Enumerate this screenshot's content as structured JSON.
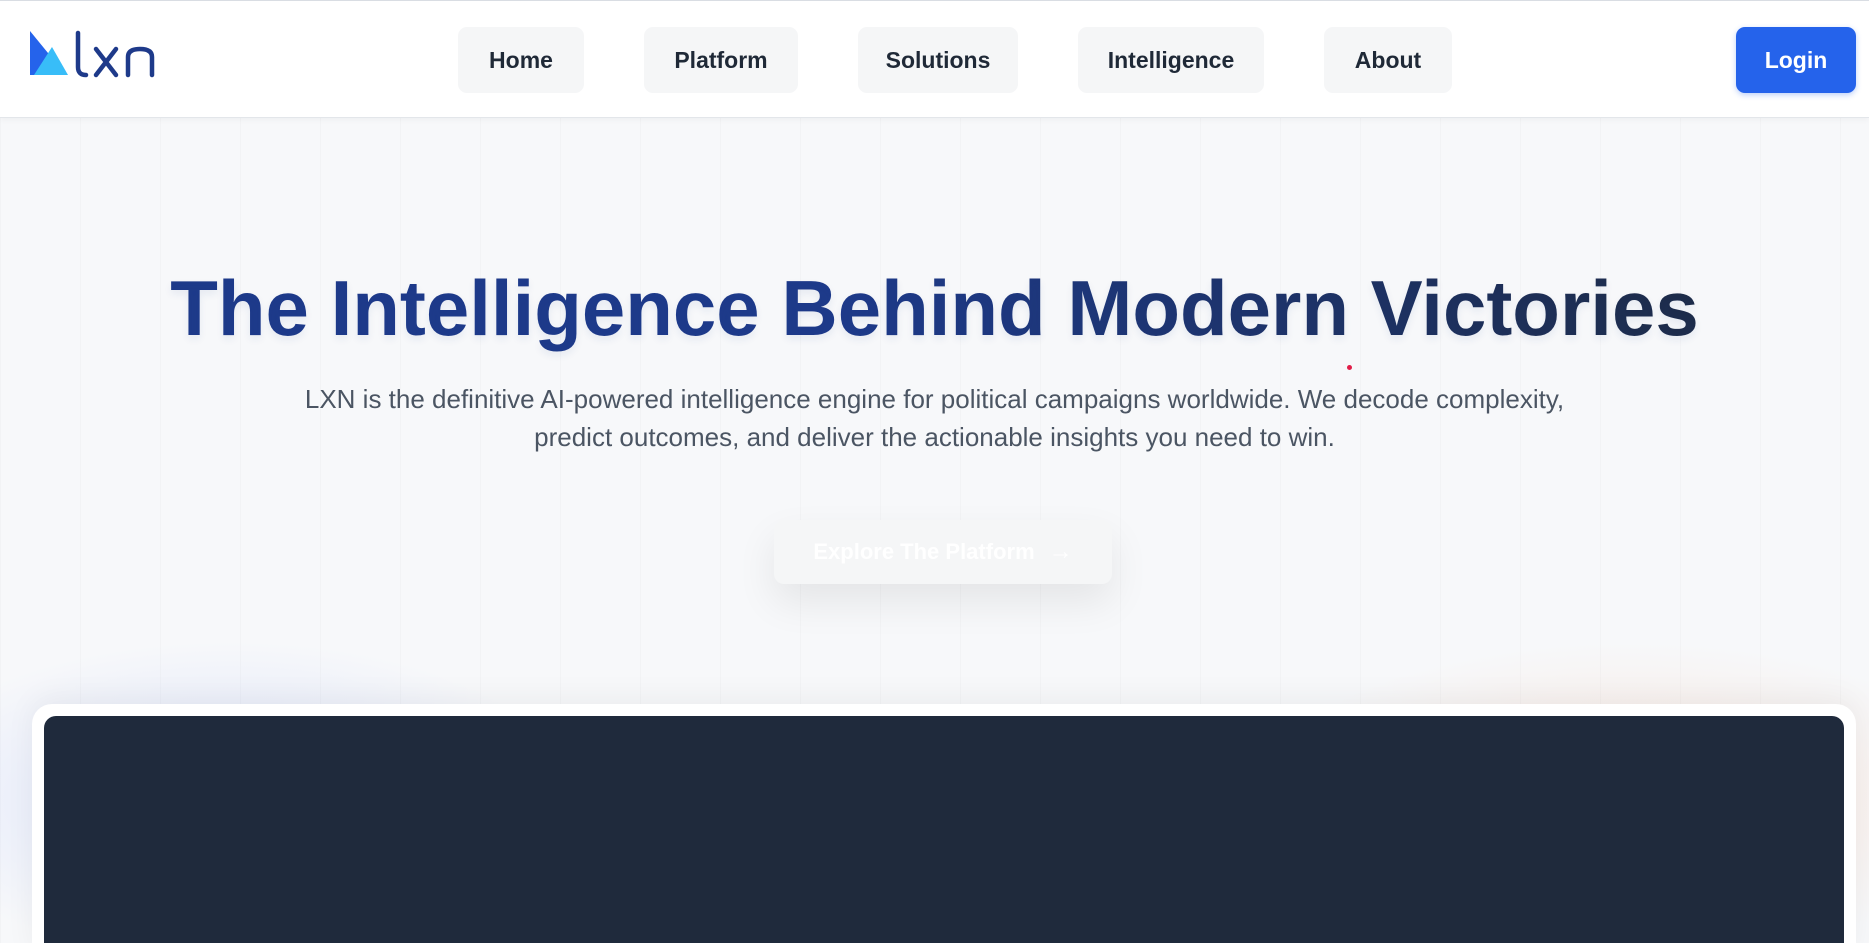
{
  "header": {
    "logo_text": "lxn",
    "nav": [
      {
        "label": "Home"
      },
      {
        "label": "Platform"
      },
      {
        "label": "Solutions"
      },
      {
        "label": "Intelligence"
      },
      {
        "label": "About"
      }
    ],
    "login_label": "Login"
  },
  "hero": {
    "title": "The Intelligence Behind Modern Victories",
    "subtitle": "LXN is the definitive AI-powered intelligence engine for political campaigns worldwide. We decode complexity, predict outcomes, and deliver the actionable insights you need to win.",
    "cta_label": "Explore The Platform",
    "cta_icon": "arrow-right-icon"
  },
  "colors": {
    "accent": "#2563eb",
    "title": "#1e3a8a",
    "preview_bg": "#1f2a3c",
    "logo_dark": "#1e3a8a",
    "logo_light": "#38bdf8"
  }
}
